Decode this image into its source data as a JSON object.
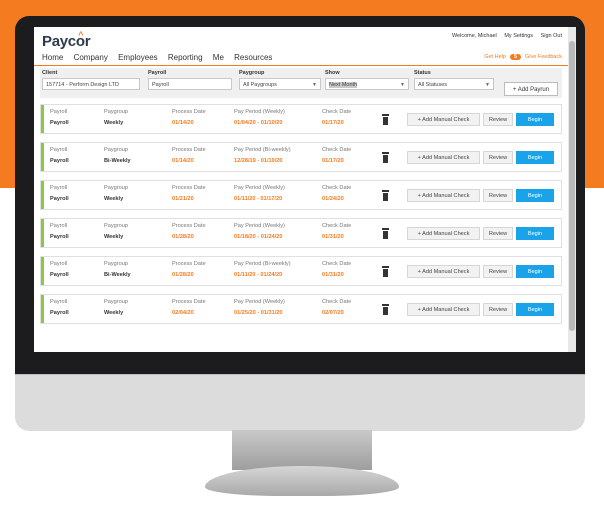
{
  "header": {
    "logo": "Paycor",
    "welcome": "Welcome, Michael",
    "my_settings": "My Settings",
    "sign_out": "Sign Out",
    "get_help": "Get Help",
    "help_count": "5",
    "give_feedback": "Give Feedback"
  },
  "nav": [
    "Home",
    "Company",
    "Employees",
    "Reporting",
    "Me",
    "Resources"
  ],
  "filters": {
    "client_label": "Client",
    "client_value": "157714 - Perform Design LTD",
    "payroll_label": "Payroll",
    "payroll_value": "Payroll",
    "paygroup_label": "Paygroup",
    "paygroup_value": "All Paygroups",
    "show_label": "Show",
    "show_value": "Next Month",
    "status_label": "Status",
    "status_value": "All Statuses",
    "add_payrun": "+ Add Payrun"
  },
  "labels": {
    "payroll": "Payroll",
    "paygroup": "Paygroup",
    "process_date": "Process Date",
    "check_date": "Check Date",
    "add_manual_check": "+ Add Manual Check",
    "review": "Review",
    "begin": "Begin"
  },
  "payruns": [
    {
      "payroll": "Payroll",
      "paygroup": "Weekly",
      "process_date": "01/14/20",
      "period_label": "Pay Period (Weekly)",
      "period": "01/04/20 - 01/10/20",
      "check_date": "01/17/20"
    },
    {
      "payroll": "Payroll",
      "paygroup": "Bi-Weekly",
      "process_date": "01/14/20",
      "period_label": "Pay Period (Bi-weekly)",
      "period": "12/28/19 - 01/10/20",
      "check_date": "01/17/20"
    },
    {
      "payroll": "Payroll",
      "paygroup": "Weekly",
      "process_date": "01/21/20",
      "period_label": "Pay Period (Weekly)",
      "period": "01/11/20 - 01/17/20",
      "check_date": "01/24/20"
    },
    {
      "payroll": "Payroll",
      "paygroup": "Weekly",
      "process_date": "01/28/20",
      "period_label": "Pay Period (Weekly)",
      "period": "01/18/20 - 01/24/20",
      "check_date": "01/31/20"
    },
    {
      "payroll": "Payroll",
      "paygroup": "Bi-Weekly",
      "process_date": "01/28/20",
      "period_label": "Pay Period (Bi-weekly)",
      "period": "01/11/20 - 01/24/20",
      "check_date": "01/31/20"
    },
    {
      "payroll": "Payroll",
      "paygroup": "Weekly",
      "process_date": "02/04/20",
      "period_label": "Pay Period (Weekly)",
      "period": "01/25/20 - 01/31/20",
      "check_date": "02/07/20"
    }
  ],
  "colors": {
    "accent": "#f47b20",
    "begin": "#1aa3e8",
    "status_bar": "#8dc63f"
  }
}
